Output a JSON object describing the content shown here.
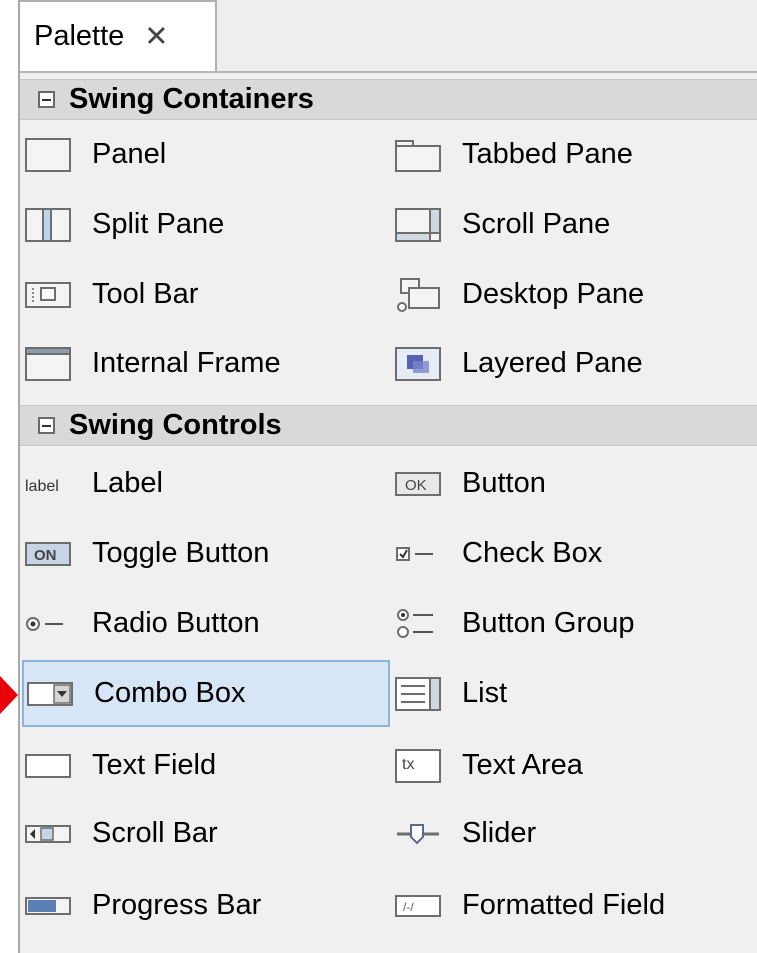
{
  "tab": {
    "label": "Palette",
    "close": "✕"
  },
  "categories": {
    "containers": "Swing Containers",
    "controls": "Swing Controls"
  },
  "containers": [
    [
      "Panel",
      "Tabbed Pane"
    ],
    [
      "Split Pane",
      "Scroll Pane"
    ],
    [
      "Tool Bar",
      "Desktop Pane"
    ],
    [
      "Internal Frame",
      "Layered Pane"
    ]
  ],
  "controls": [
    [
      "Label",
      "Button"
    ],
    [
      "Toggle Button",
      "Check Box"
    ],
    [
      "Radio Button",
      "Button Group"
    ],
    [
      "Combo Box",
      "List"
    ],
    [
      "Text Field",
      "Text Area"
    ],
    [
      "Scroll Bar",
      "Slider"
    ],
    [
      "Progress Bar",
      "Formatted Field"
    ]
  ],
  "icon_text": {
    "label": "label",
    "button": "OK",
    "toggle": "ON",
    "textarea": "tx"
  },
  "selected_item": "Combo Box",
  "colors": {
    "selection_bg": "#d6e6f6",
    "selection_border": "#8bb4da",
    "marker": "#e8000b"
  }
}
